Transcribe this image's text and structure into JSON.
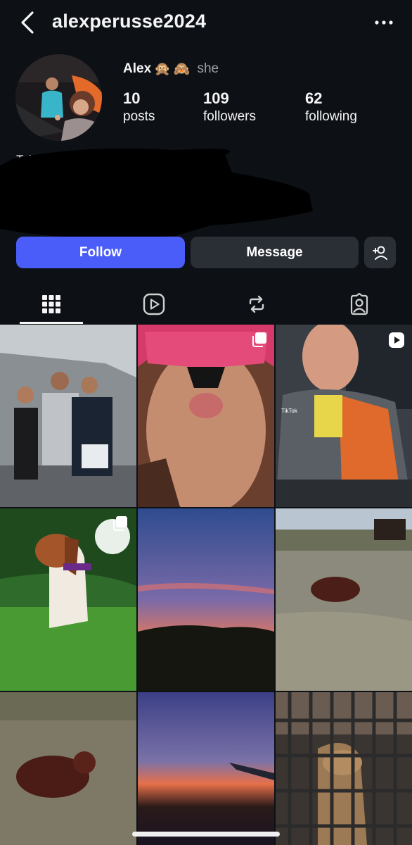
{
  "header": {
    "back_icon": "chevron-left-icon",
    "username": "alexperusse2024",
    "more_icon": "more-horizontal-icon"
  },
  "profile": {
    "display_name": "Alex",
    "emoji": [
      "🙊",
      "🙈"
    ],
    "pronoun": "she",
    "bio": "Taken",
    "bio_emoji": "💋"
  },
  "stats": [
    {
      "value": "10",
      "label": "posts"
    },
    {
      "value": "109",
      "label": "followers"
    },
    {
      "value": "62",
      "label": "following"
    }
  ],
  "actions": {
    "follow_label": "Follow",
    "message_label": "Message",
    "add_user_icon": "add-user-icon"
  },
  "tabs": [
    {
      "icon": "grid-icon",
      "selected": true
    },
    {
      "icon": "reels-icon",
      "selected": false
    },
    {
      "icon": "reposts-icon",
      "selected": false
    },
    {
      "icon": "tagged-icon",
      "selected": false
    }
  ],
  "posts": [
    {
      "subject": "group photo under tent",
      "badge": ""
    },
    {
      "subject": "selfie with snorkel mask",
      "badge": "carousel-icon"
    },
    {
      "subject": "older man in orange jacket",
      "badge": "reel-icon",
      "overlay_text": "TikTok"
    },
    {
      "subject": "beagle on grass",
      "badge": "carousel-icon"
    },
    {
      "subject": "sunset over hills",
      "badge": ""
    },
    {
      "subject": "calf in field with cow",
      "badge": ""
    },
    {
      "subject": "calf lying in field",
      "badge": ""
    },
    {
      "subject": "sunset from airplane window",
      "badge": ""
    },
    {
      "subject": "lizard behind cage",
      "badge": ""
    }
  ],
  "colors": {
    "background": "#0d1116",
    "follow_button": "#4a5df9",
    "secondary_button": "#2a2e35"
  }
}
